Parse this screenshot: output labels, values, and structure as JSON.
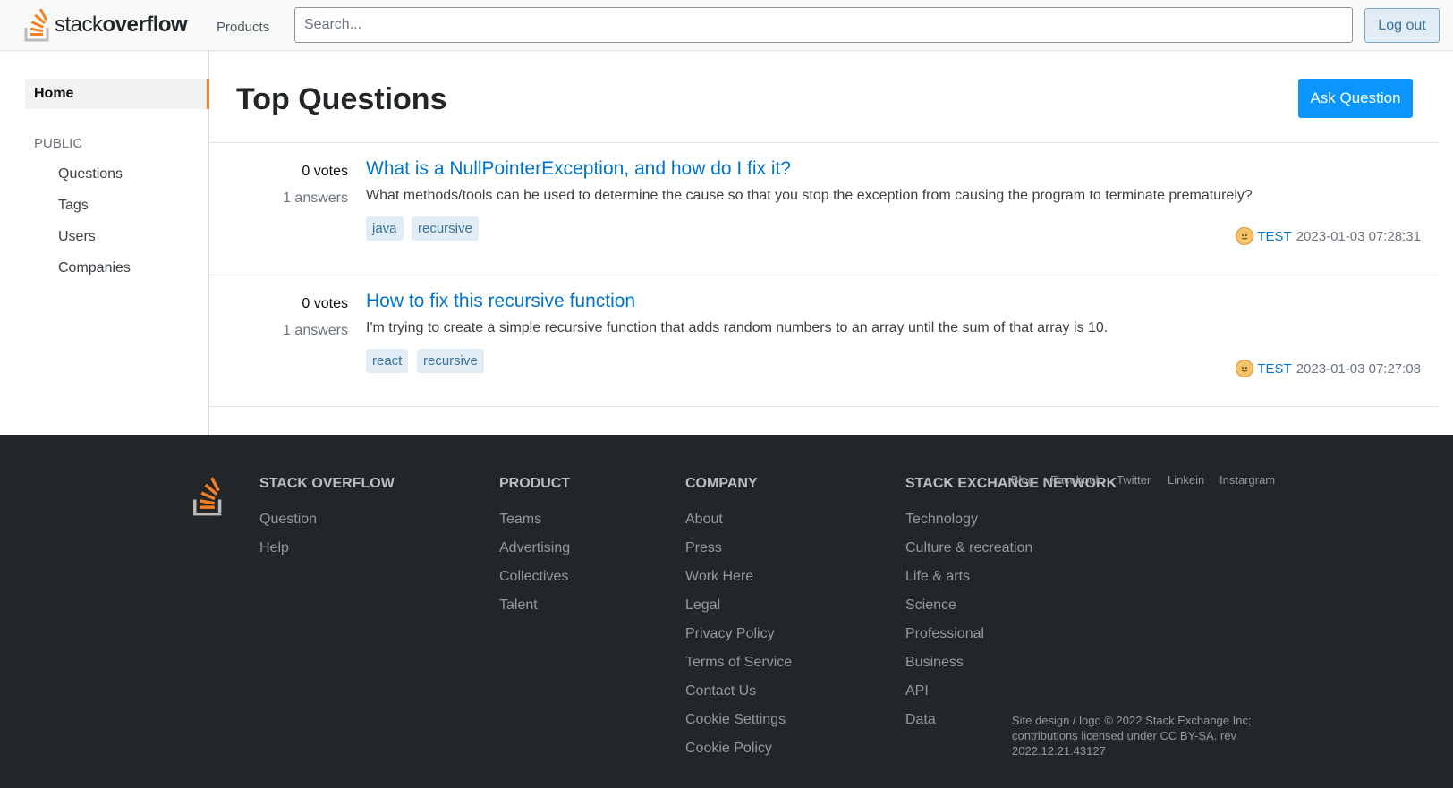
{
  "header": {
    "logo_regular": "stack",
    "logo_bold": "overflow",
    "products_label": "Products",
    "search_placeholder": "Search...",
    "logout_label": "Log out"
  },
  "sidebar": {
    "home_label": "Home",
    "section_label": "PUBLIC",
    "items": [
      {
        "label": "Questions"
      },
      {
        "label": "Tags"
      },
      {
        "label": "Users"
      },
      {
        "label": "Companies"
      }
    ]
  },
  "main": {
    "title": "Top Questions",
    "ask_button": "Ask Question",
    "questions": [
      {
        "votes": "0 votes",
        "answers": "1 answers",
        "title": "What is a NullPointerException, and how do I fix it?",
        "excerpt": "What methods/tools can be used to determine the cause so that you stop the exception from causing the program to terminate prematurely?",
        "tags": [
          "java",
          "recursive"
        ],
        "author": "TEST",
        "date": "2023-01-03 07:28:31"
      },
      {
        "votes": "0 votes",
        "answers": "1 answers",
        "title": "How to fix this recursive function",
        "excerpt": "I'm trying to create a simple recursive function that adds random numbers to an array until the sum of that array is 10.",
        "tags": [
          "react",
          "recursive"
        ],
        "author": "TEST",
        "date": "2023-01-03 07:27:08"
      }
    ]
  },
  "footer": {
    "columns": [
      {
        "heading": "STACK OVERFLOW",
        "links": [
          "Question",
          "Help"
        ]
      },
      {
        "heading": "PRODUCT",
        "links": [
          "Teams",
          "Advertising",
          "Collectives",
          "Talent"
        ]
      },
      {
        "heading": "COMPANY",
        "links": [
          "About",
          "Press",
          "Work Here",
          "Legal",
          "Privacy Policy",
          "Terms of Service",
          "Contact Us",
          "Cookie Settings",
          "Cookie Policy"
        ]
      },
      {
        "heading": "STACK EXCHANGE NETWORK",
        "links": [
          "Technology",
          "Culture & recreation",
          "Life & arts",
          "Science",
          "Professional",
          "Business",
          "API",
          "Data"
        ]
      }
    ],
    "social": [
      "Blog",
      "Facebook",
      "Twitter",
      "Linkein",
      "Instargram"
    ],
    "copyright": "Site design / logo © 2022 Stack Exchange Inc; contributions licensed under CC BY-SA. rev 2022.12.21.43127"
  },
  "colors": {
    "accent_orange": "#f48225",
    "link_blue": "#0074cc",
    "button_blue": "#0a95ff",
    "tag_bg": "#e1ecf4",
    "footer_bg": "#232629"
  }
}
